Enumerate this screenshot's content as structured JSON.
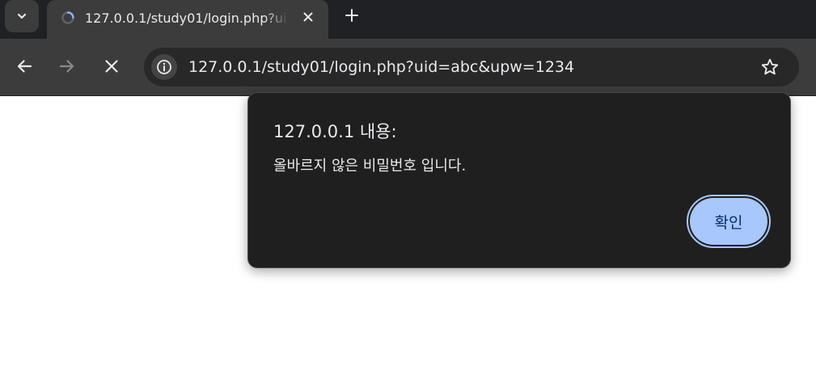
{
  "window": {
    "background": "#ffffff",
    "chrome_dark": "#202124",
    "toolbar_color": "#3c3c3c",
    "accent": "#a8c7fa"
  },
  "tabs": {
    "menu_icon": "chevron-down-icon",
    "active": {
      "title": "127.0.0.1/study01/login.php?uid=abc&upw=1234",
      "favicon": "loading-favicon-icon",
      "close_icon": "close-icon"
    },
    "new_tab_icon": "plus-icon"
  },
  "toolbar": {
    "back_icon": "arrow-left-icon",
    "forward_icon": "arrow-right-icon",
    "stop_icon": "close-icon",
    "site_info_icon": "info-icon",
    "url": "127.0.0.1/study01/login.php?uid=abc&upw=1234",
    "bookmark_icon": "star-icon"
  },
  "dialog": {
    "title": "127.0.0.1 내용:",
    "message": "올바르지 않은 비밀번호 입니다.",
    "ok_label": "확인"
  }
}
